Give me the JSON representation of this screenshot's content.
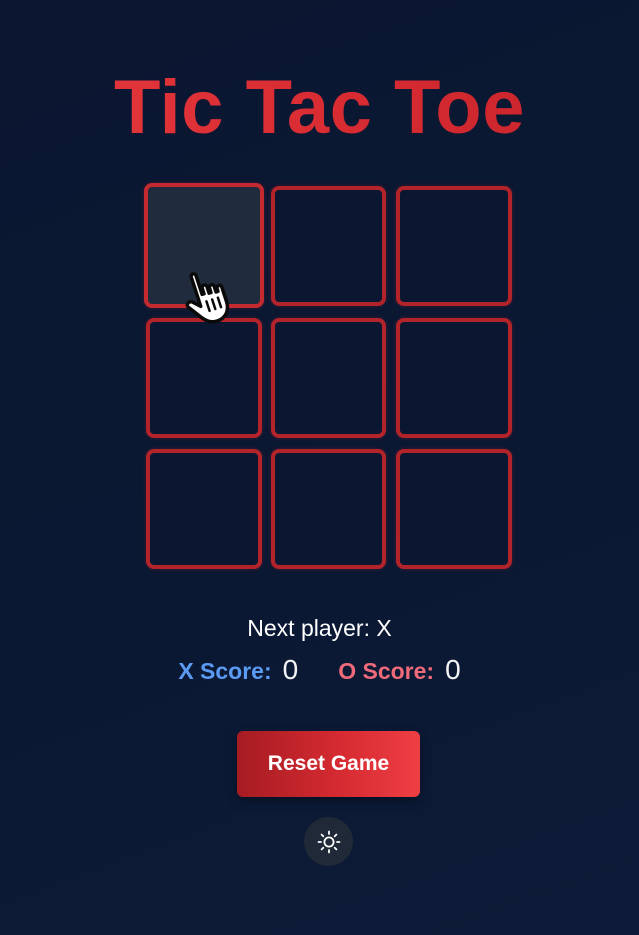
{
  "title": "Tic Tac Toe",
  "board": {
    "cells": [
      "",
      "",
      "",
      "",
      "",
      "",
      "",
      "",
      ""
    ],
    "hovered_cell": 0
  },
  "status": {
    "text": "Next player: X"
  },
  "scores": {
    "x_label": "X Score:",
    "x_value": "0",
    "o_label": "O Score:",
    "o_value": "0"
  },
  "controls": {
    "reset_label": "Reset Game",
    "theme_icon": "sun-icon"
  },
  "colors": {
    "accent_red": "#d92c33",
    "cell_border": "#b3232a",
    "background": "#0b1731",
    "x_color": "#5b9bf2",
    "o_color": "#f06b7a"
  }
}
